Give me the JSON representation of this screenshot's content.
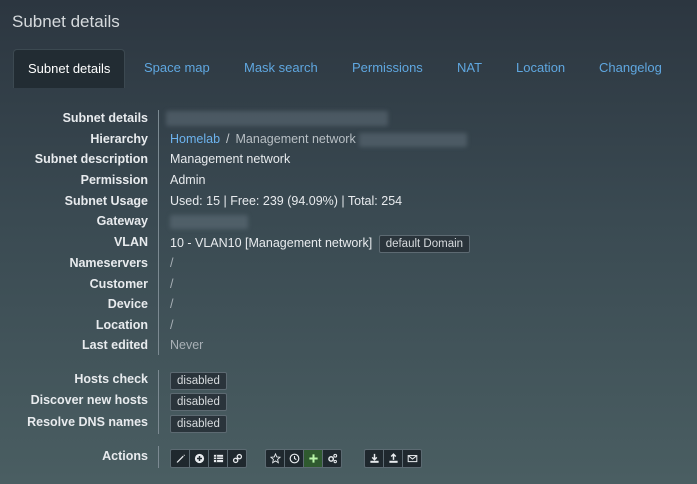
{
  "panel": {
    "title": "Subnet details"
  },
  "tabs": [
    {
      "label": "Subnet details",
      "active": true
    },
    {
      "label": "Space map"
    },
    {
      "label": "Mask search"
    },
    {
      "label": "Permissions"
    },
    {
      "label": "NAT"
    },
    {
      "label": "Location"
    },
    {
      "label": "Changelog"
    }
  ],
  "details": {
    "subnet_details": {
      "label": "Subnet details"
    },
    "hierarchy": {
      "label": "Hierarchy",
      "root": "Homelab",
      "separator": "/",
      "current": "Management network"
    },
    "description": {
      "label": "Subnet description",
      "value": "Management network"
    },
    "permission": {
      "label": "Permission",
      "value": "Admin"
    },
    "usage": {
      "label": "Subnet Usage",
      "value": "Used: 15 | Free: 239 (94.09%) | Total: 254"
    },
    "gateway": {
      "label": "Gateway"
    },
    "vlan": {
      "label": "VLAN",
      "value": "10 - VLAN10 [Management network]",
      "badge": "default Domain"
    },
    "nameservers": {
      "label": "Nameservers",
      "value": "/"
    },
    "customer": {
      "label": "Customer",
      "value": "/"
    },
    "device": {
      "label": "Device",
      "value": "/"
    },
    "location": {
      "label": "Location",
      "value": "/"
    },
    "last_edited": {
      "label": "Last edited",
      "value": "Never"
    }
  },
  "scan": {
    "hosts_check": {
      "label": "Hosts check",
      "value": "disabled"
    },
    "discover": {
      "label": "Discover new hosts",
      "value": "disabled"
    },
    "resolve": {
      "label": "Resolve DNS names",
      "value": "disabled"
    }
  },
  "actions": {
    "label": "Actions",
    "icons": [
      "pencil-icon",
      "plus-circle-icon",
      "list-icon",
      "link-icon",
      "star-icon",
      "clock-icon",
      "plus-icon",
      "cogs-icon",
      "download-icon",
      "upload-icon",
      "envelope-icon"
    ]
  },
  "colors": {
    "link": "#6db3ee",
    "active_tab_bg": "#222c33",
    "green_button": "#2f5a2f"
  }
}
